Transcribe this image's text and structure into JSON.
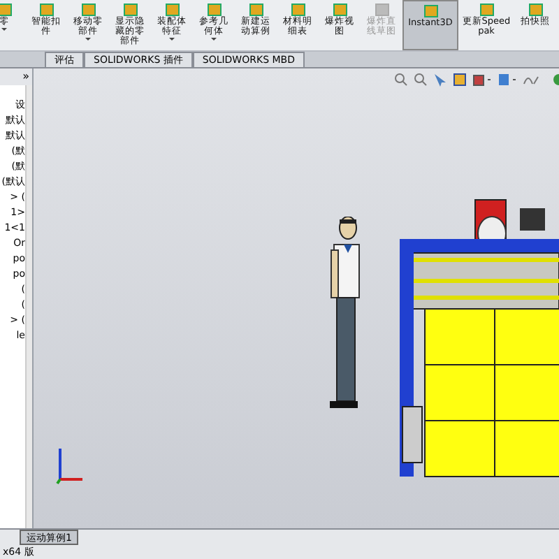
{
  "ribbon": {
    "buttons": [
      {
        "label": "零",
        "disabled": false,
        "selected": false,
        "dropdown": true
      },
      {
        "label": "智能扣件",
        "disabled": false,
        "selected": false,
        "dropdown": false
      },
      {
        "label": "移动零部件",
        "disabled": false,
        "selected": false,
        "dropdown": true
      },
      {
        "label": "显示隐藏的零部件",
        "disabled": false,
        "selected": false,
        "dropdown": false
      },
      {
        "label": "装配体特征",
        "disabled": false,
        "selected": false,
        "dropdown": true
      },
      {
        "label": "参考几何体",
        "disabled": false,
        "selected": false,
        "dropdown": true
      },
      {
        "label": "新建运动算例",
        "disabled": false,
        "selected": false,
        "dropdown": false
      },
      {
        "label": "材料明细表",
        "disabled": false,
        "selected": false,
        "dropdown": false
      },
      {
        "label": "爆炸视图",
        "disabled": false,
        "selected": false,
        "dropdown": false
      },
      {
        "label": "爆炸直线草图",
        "disabled": true,
        "selected": false,
        "dropdown": false
      },
      {
        "label": "Instant3D",
        "disabled": false,
        "selected": true,
        "dropdown": false
      },
      {
        "label": "更新Speedpak",
        "disabled": false,
        "selected": false,
        "dropdown": false
      },
      {
        "label": "拍快照",
        "disabled": false,
        "selected": false,
        "dropdown": false
      }
    ]
  },
  "tabs": [
    {
      "label": "评估",
      "selected": false
    },
    {
      "label": "SOLIDWORKS 插件",
      "selected": false
    },
    {
      "label": "SOLIDWORKS MBD",
      "selected": false
    }
  ],
  "panel": {
    "expand": "»",
    "items": [
      "设",
      "默认",
      "默认",
      "(默",
      "(默",
      "(默认",
      "> (",
      "1>",
      "1<1",
      "Or",
      "po",
      "po",
      "(",
      "(",
      "> (",
      "le"
    ]
  },
  "bottom_tabs": [
    {
      "label": "运动算例1",
      "selected": true
    }
  ],
  "status_bar": "x64 版"
}
